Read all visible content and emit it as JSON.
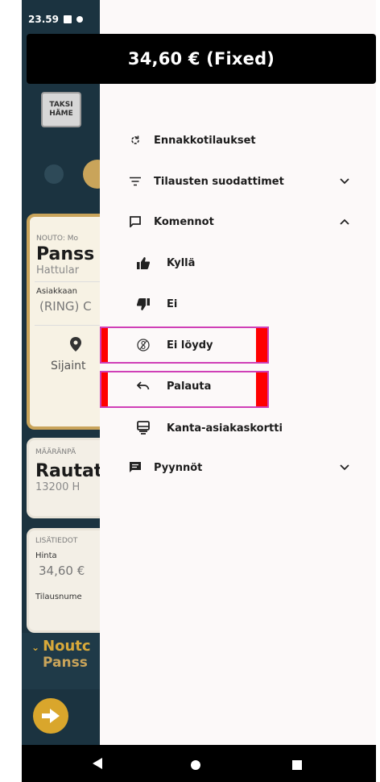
{
  "status_bar": {
    "time": "23.59"
  },
  "price_header": {
    "text": "34,60 € (Fixed)"
  },
  "background_app": {
    "logo": {
      "line1": "TAKSI",
      "line2": "HÄME"
    },
    "pickup_card": {
      "label": "NOUTO: Mo",
      "name": "Panss",
      "address": "Hattular",
      "customer_label": "Asiakkaan",
      "customer_value": "(RING) C",
      "location_label": "Sijaint"
    },
    "destination_card": {
      "label": "MÄÄRÄNPÄ",
      "name": "Rautat",
      "address": "13200 H"
    },
    "extra_card": {
      "label": "LISÄTIEDOT",
      "price_label": "Hinta",
      "price_value": "34,60 €",
      "order_label": "Tilausnume"
    },
    "bottom_bar": {
      "title": "Noutc",
      "subtitle": "Panss"
    }
  },
  "drawer": {
    "items": [
      {
        "label": "Ennakkotilaukset",
        "icon": "refresh-icon"
      },
      {
        "label": "Tilausten suodattimet",
        "icon": "filter-icon",
        "chevron": "down"
      },
      {
        "label": "Komennot",
        "icon": "comment-icon",
        "chevron": "up"
      },
      {
        "label": "Kyllä",
        "icon": "thumbs-up-icon"
      },
      {
        "label": "Ei",
        "icon": "thumbs-down-icon"
      },
      {
        "label": "Ei löydy",
        "icon": "not-found-icon"
      },
      {
        "label": "Palauta",
        "icon": "undo-icon"
      },
      {
        "label": "Kanta-asiakaskortti",
        "icon": "card-icon"
      },
      {
        "label": "Pyynnöt",
        "icon": "message-icon",
        "chevron": "down"
      }
    ]
  },
  "colors": {
    "app_background": "#1b3340",
    "accent_gold": "#c9a45a",
    "highlight_border": "#cf3fb7",
    "highlight_marker": "#ff0000",
    "drawer_background": "#fcf9f9"
  }
}
